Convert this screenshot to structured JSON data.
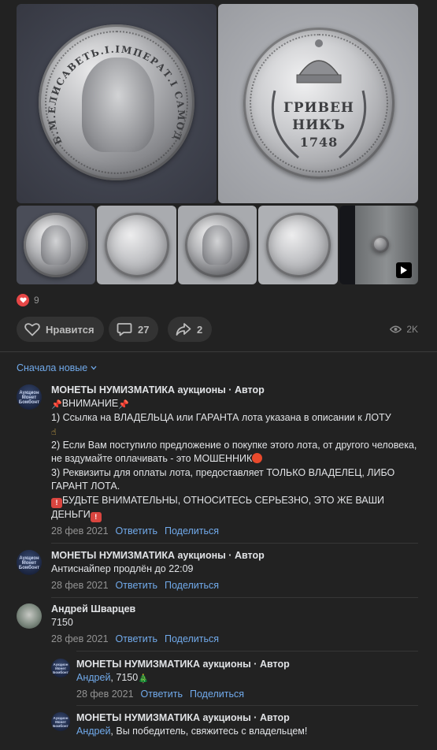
{
  "post": {
    "photos": [
      {
        "name": "photo-obverse-large",
        "desc": "obverse"
      },
      {
        "name": "photo-reverse-large",
        "desc": "reverse"
      },
      {
        "name": "thumb-1"
      },
      {
        "name": "thumb-2"
      },
      {
        "name": "thumb-3"
      },
      {
        "name": "thumb-4"
      },
      {
        "name": "thumb-video"
      }
    ],
    "coin_obverse_legend": "Б.М.ЕЛИСАВЕТЬ.I.IМПЕРАТ.I САМОДЕРЖ.ВСЕРОС.",
    "coin_reverse_lines": [
      "ГРИВЕН",
      "НИКЪ",
      "1748"
    ],
    "reactions_count": "9",
    "actions": {
      "like_label": "Нравится",
      "comments_count": "27",
      "shares_count": "2"
    },
    "views": "2K"
  },
  "sort_label": "Сначала новые",
  "comments": [
    {
      "author": "МОНЕТЫ НУМИЗМАТИКА аукционы · Автор",
      "avatar_text": "Аукцион Монет Бомбонт",
      "lines": {
        "l1": "ВНИМАНИЕ",
        "l2a": "1) Ссылка на ВЛАДЕЛЬЦА или ГАРАНТА лота указана в описании к ЛОТУ",
        "l3": "2) Если Вам поступило предложение о покупке этого лота, от другого человека, не вздумайте оплачивать - это МОШЕННИК",
        "l4": "3) Реквизиты для оплаты лота, предоставляет ТОЛЬКО ВЛАДЕЛЕЦ, ЛИБО ГАРАНТ ЛОТА.",
        "l5": "БУДЬТЕ ВНИМАТЕЛЬНЫ, ОТНОСИТЕСЬ СЕРЬЕЗНО, ЭТО ЖЕ ВАШИ ДЕНЬГИ"
      },
      "date": "28 фев 2021",
      "reply": "Ответить",
      "share": "Поделиться"
    },
    {
      "author": "МОНЕТЫ НУМИЗМАТИКА аукционы · Автор",
      "avatar_text": "Аукцион Монет Бомбонт",
      "text": "Антиснайпер продлён до 22:09",
      "date": "28 фев 2021",
      "reply": "Ответить",
      "share": "Поделиться"
    },
    {
      "author": "Андрей Шварцев",
      "text": "7150",
      "date": "28 фев 2021",
      "reply": "Ответить",
      "share": "Поделиться"
    },
    {
      "author": "МОНЕТЫ НУМИЗМАТИКА аукционы · Автор",
      "avatar_text": "Аукцион Монет Бомбонт",
      "mention": "Андрей",
      "text": ", 7150",
      "date": "28 фев 2021",
      "reply": "Ответить",
      "share": "Поделиться"
    },
    {
      "author": "МОНЕТЫ НУМИЗМАТИКА аукционы · Автор",
      "avatar_text": "Аукцион Монет Бомбонт",
      "mention": "Андрей",
      "text": ", Вы победитель, свяжитесь с владельцем!"
    }
  ],
  "colors": {
    "background": "#222222",
    "link": "#71aaeb",
    "muted": "#939393",
    "like_red": "#e64646"
  }
}
